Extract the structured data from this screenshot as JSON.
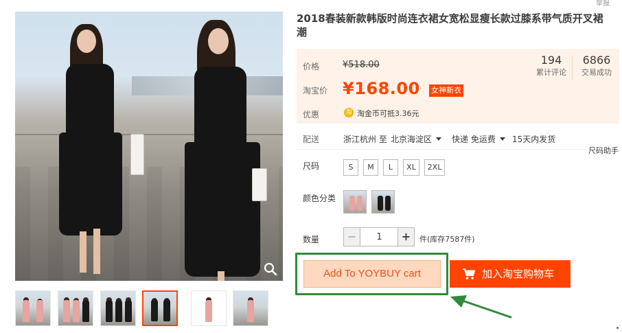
{
  "product": {
    "title": "2018春装新款韩版时尚连衣裙女宽松显瘦长款过膝系带气质开叉裙潮",
    "top_link": "举报"
  },
  "price": {
    "orig_label": "价格",
    "orig_value": "¥518.00",
    "promo_label": "淘宝价",
    "promo_value": "¥168.00",
    "promo_tag": "女神新衣",
    "reviews_count": "194",
    "reviews_label": "累计评论",
    "sales_count": "6866",
    "sales_label": "交易成功",
    "coupon_label": "优惠",
    "coupon_icon_text": "淘",
    "coupon_text": "淘金币可抵3.36元"
  },
  "shipping": {
    "label": "配送",
    "from": "浙江杭州 至",
    "to": "北京海淀区",
    "method": "快递 免运费",
    "dispatch": "15天内发货",
    "size_helper": "尺码助手"
  },
  "options": {
    "size_label": "尺码",
    "sizes": [
      "S",
      "M",
      "L",
      "XL",
      "2XL"
    ],
    "color_label": "颜色分类",
    "quantity_label": "数量",
    "quantity_value": "1",
    "minus": "−",
    "plus": "+",
    "stock": "件(库存7587件)"
  },
  "actions": {
    "yoybuy_label": "Add To YOYBUY cart",
    "taobao_label": "加入淘宝购物车"
  },
  "colors": {
    "accent": "#ff4400",
    "highlight_border": "#2f8a3c",
    "panel_bg": "#fff2e8"
  },
  "icons": {
    "zoom": "magnifier-icon",
    "cart": "cart-icon",
    "coin": "coin-icon",
    "arrow": "arrow-icon"
  }
}
